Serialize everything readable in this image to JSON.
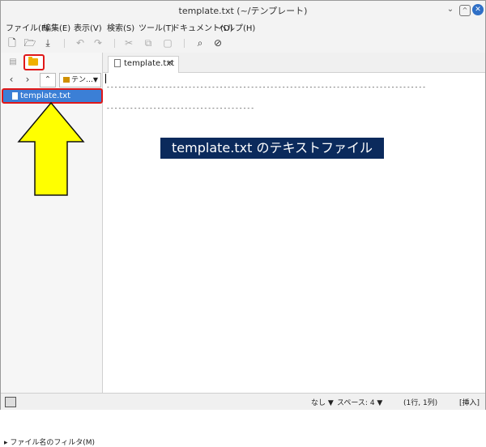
{
  "window": {
    "title": "template.txt (~/テンプレート)"
  },
  "menubar": [
    "ファイル(F)",
    "編集(E)",
    "表示(V)",
    "検索(S)",
    "ツール(T)",
    "ドキュメント(D)",
    "ヘルプ(H)"
  ],
  "toolbar": {
    "icons": [
      "new-document-icon",
      "open-folder-icon",
      "save-icon",
      "undo-icon",
      "redo-icon",
      "cut-icon",
      "copy-icon",
      "paste-icon",
      "search-icon",
      "replace-icon"
    ]
  },
  "sidepanel": {
    "location": "テン…",
    "file_item": "template.txt",
    "filter_label": "ファイル名のフィルタ(M)"
  },
  "editor": {
    "tab_label": "template.txt",
    "line1": "------------------------------------------------------------------------------------------------",
    "line3": "------------------------------------------"
  },
  "annotation": {
    "text": "template.txt のテキストファイル"
  },
  "statusbar": {
    "syntax": "なし",
    "spaces": "スペース: 4",
    "position": "(1行, 1列)",
    "mode": "[挿入]"
  },
  "colors": {
    "selection": "#3b7fd6",
    "highlight_border": "#e01818",
    "arrow_fill": "#ffff00",
    "annotation_bg": "#0b2a5c"
  }
}
